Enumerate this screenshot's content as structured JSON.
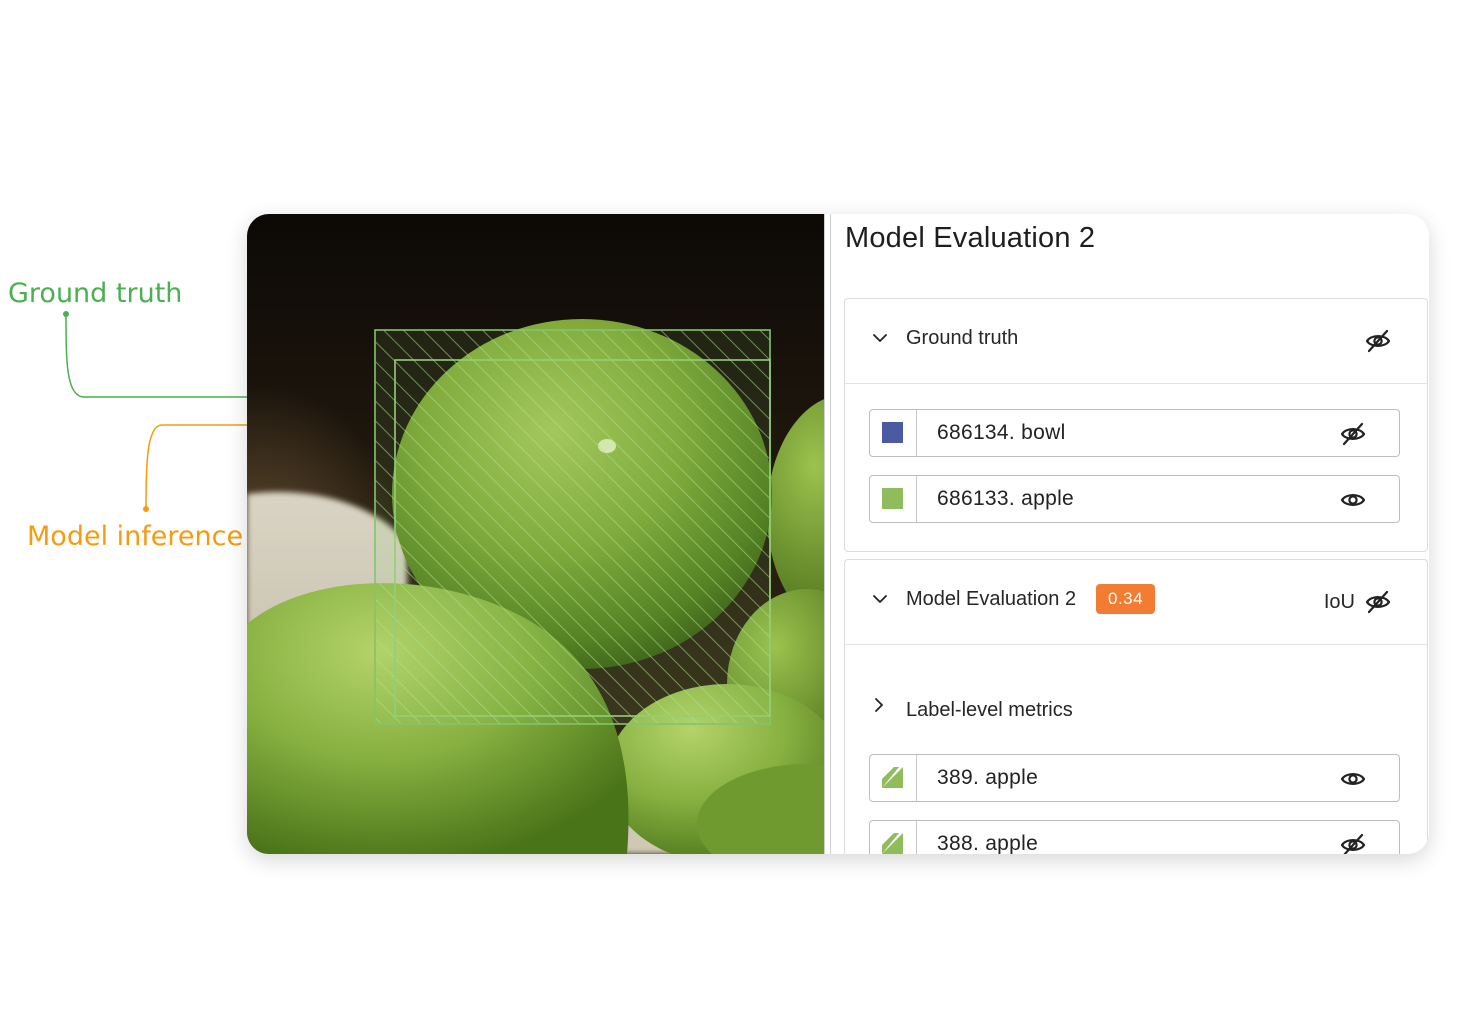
{
  "callouts": {
    "ground_truth": "Ground truth",
    "model_inference": "Model inference",
    "ground_truth_color": "#4caf50",
    "model_inference_color": "#f39c12"
  },
  "panel": {
    "title": "Model Evaluation 2",
    "ground_truth_section": {
      "title": "Ground truth",
      "items": [
        {
          "label": "686134. bowl",
          "color": "#4b5aa3",
          "visible": false
        },
        {
          "label": "686133. apple",
          "color": "#8fbd5c",
          "visible": true
        }
      ]
    },
    "evaluation_section": {
      "title": "Model Evaluation 2",
      "score": "0.34",
      "metric": "IoU",
      "sub_section": "Label-level metrics",
      "items": [
        {
          "label": "389. apple",
          "color": "#8fbd5c",
          "visible": true
        },
        {
          "label": "388. apple",
          "color": "#8fbd5c",
          "visible": false
        }
      ]
    }
  }
}
